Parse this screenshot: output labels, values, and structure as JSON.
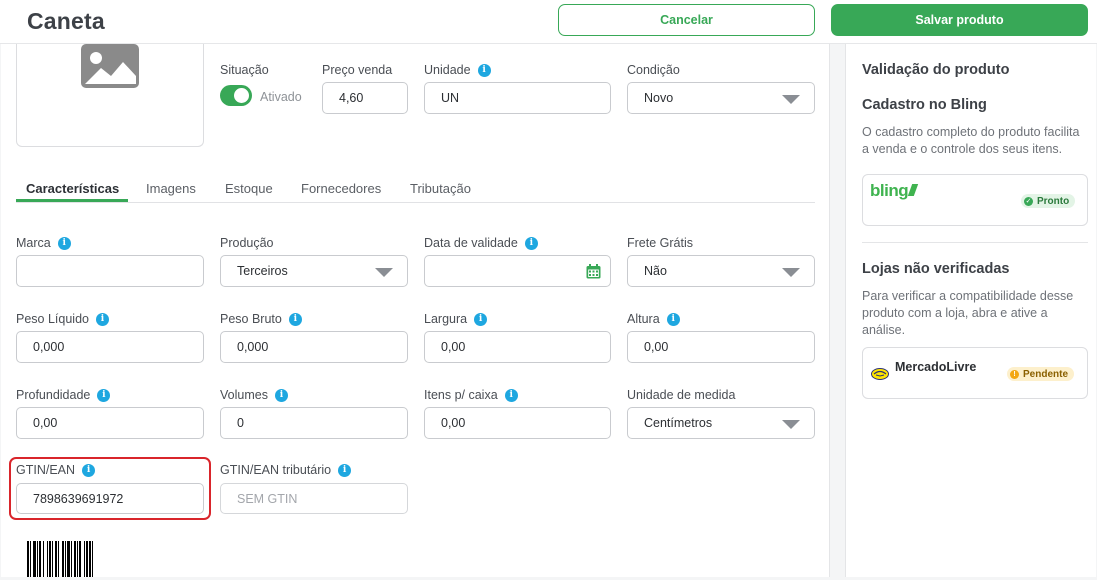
{
  "header": {
    "title": "Caneta",
    "cancel_label": "Cancelar",
    "save_label": "Salvar produto"
  },
  "general": {
    "situacao_label": "Situação",
    "situacao_value": "Ativado",
    "preco_label": "Preço venda",
    "preco_value": "4,60",
    "unidade_label": "Unidade",
    "unidade_value": "UN",
    "condicao_label": "Condição",
    "condicao_value": "Novo"
  },
  "tabs": [
    {
      "label": "Características"
    },
    {
      "label": "Imagens"
    },
    {
      "label": "Estoque"
    },
    {
      "label": "Fornecedores"
    },
    {
      "label": "Tributação"
    }
  ],
  "fields": {
    "marca": {
      "label": "Marca",
      "value": ""
    },
    "producao": {
      "label": "Produção",
      "value": "Terceiros"
    },
    "validade": {
      "label": "Data de validade",
      "value": ""
    },
    "frete": {
      "label": "Frete Grátis",
      "value": "Não"
    },
    "peso_liquido": {
      "label": "Peso Líquido",
      "value": "0,000"
    },
    "peso_bruto": {
      "label": "Peso Bruto",
      "value": "0,000"
    },
    "largura": {
      "label": "Largura",
      "value": "0,00"
    },
    "altura": {
      "label": "Altura",
      "value": "0,00"
    },
    "profundidade": {
      "label": "Profundidade",
      "value": "0,00"
    },
    "volumes": {
      "label": "Volumes",
      "value": "0"
    },
    "itens_caixa": {
      "label": "Itens p/ caixa",
      "value": "0,00"
    },
    "unidade_medida": {
      "label": "Unidade de medida",
      "value": "Centímetros"
    },
    "gtin": {
      "label": "GTIN/EAN",
      "value": "7898639691972"
    },
    "gtin_trib": {
      "label": "GTIN/EAN tributário",
      "placeholder": "SEM GTIN"
    }
  },
  "sidebar": {
    "title": "Validação do produto",
    "bling_heading": "Cadastro no Bling",
    "bling_text": "O cadastro completo do produto facilita a venda e o controle dos seus itens.",
    "bling_logo": "bling",
    "bling_status": "Pronto",
    "stores_heading": "Lojas não verificadas",
    "stores_text": "Para verificar a compatibilidade desse produto com a loja, abra e ative a análise.",
    "store_name": "MercadoLivre",
    "store_status": "Pendente"
  },
  "colors": {
    "accent": "#38a857",
    "info": "#1ea7e0",
    "highlight": "#d9252b"
  }
}
